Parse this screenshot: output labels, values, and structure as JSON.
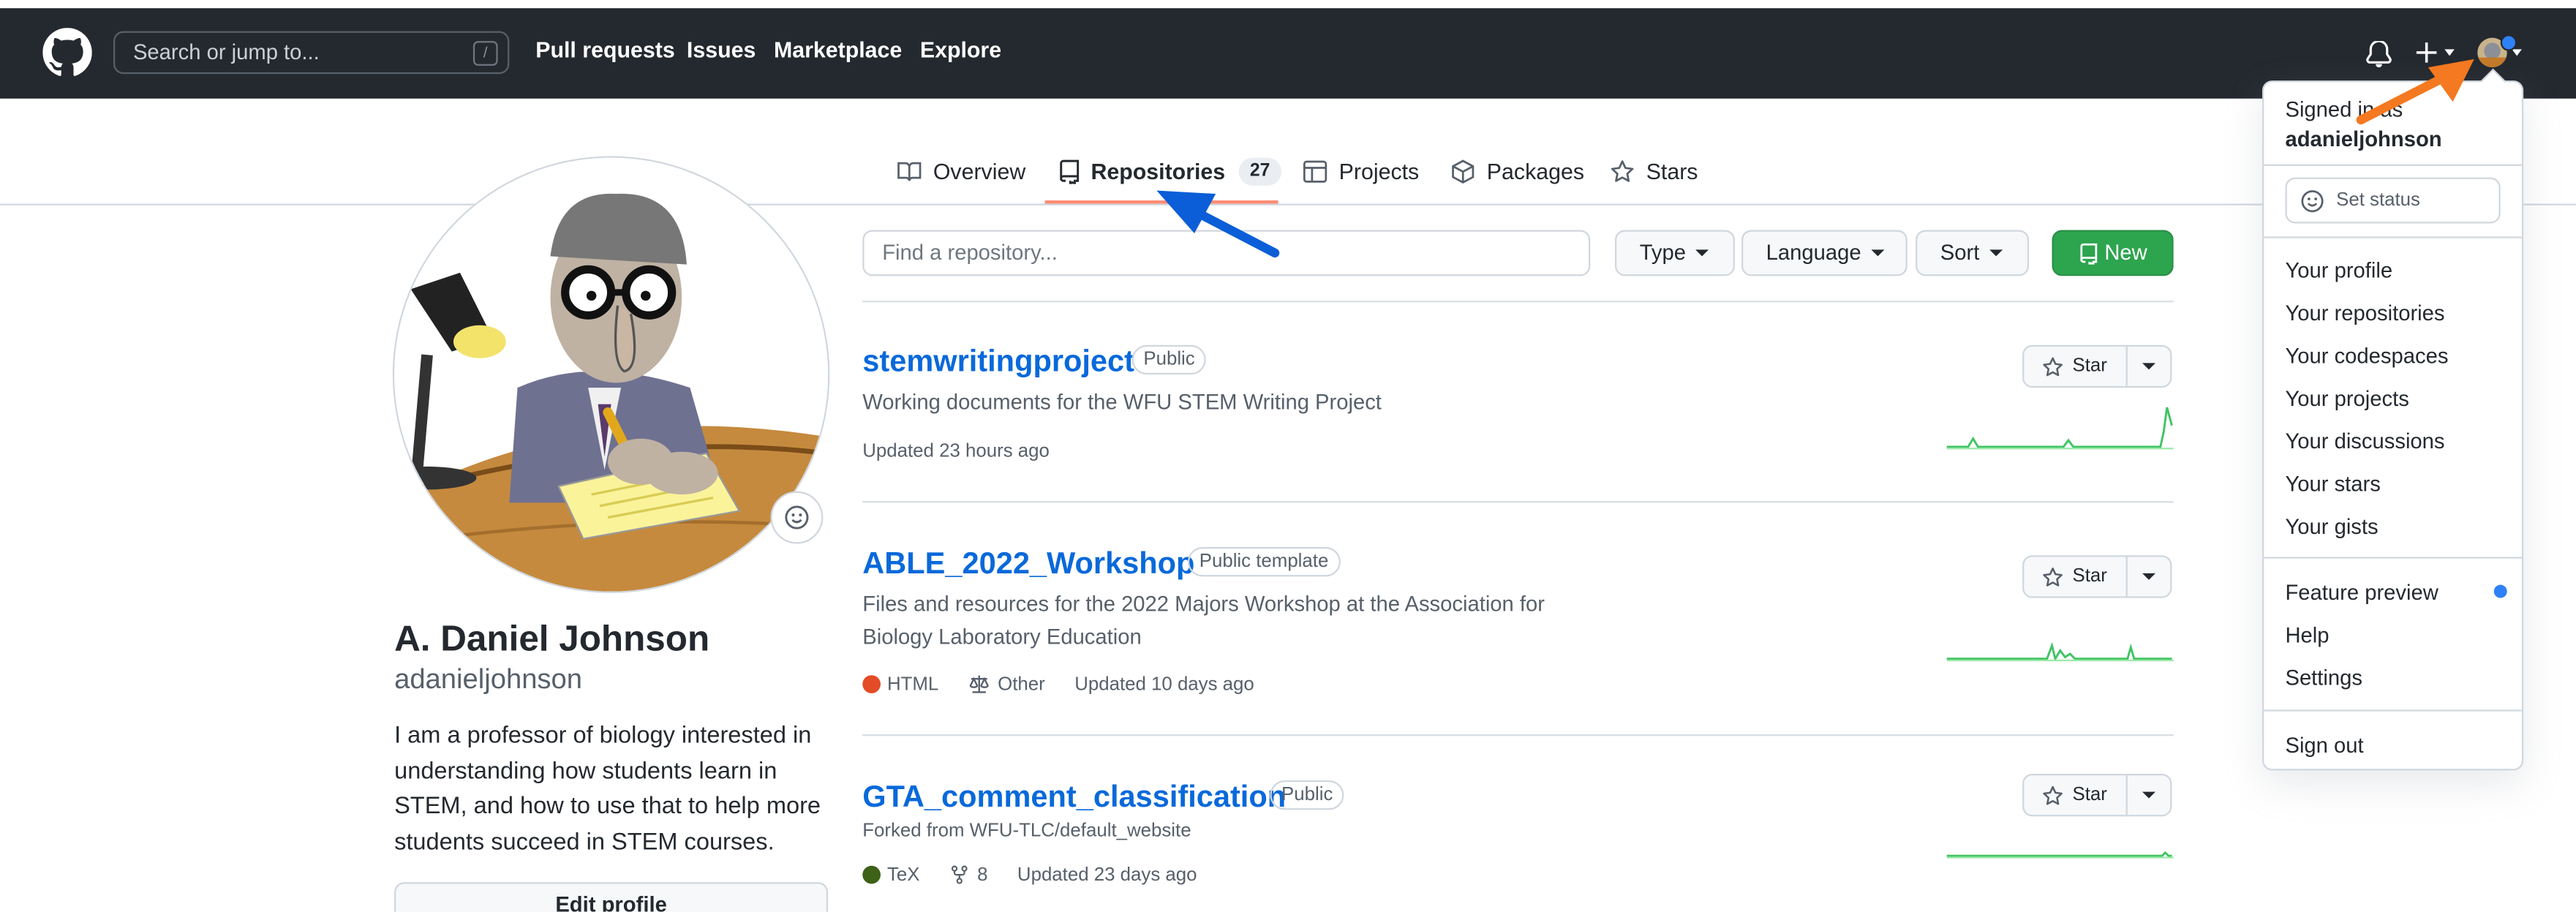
{
  "header": {
    "search_placeholder": "Search or jump to...",
    "search_shortcut": "/",
    "nav": [
      "Pull requests",
      "Issues",
      "Marketplace",
      "Explore"
    ],
    "icons": [
      "github-logo-icon",
      "bell-icon",
      "plus-icon",
      "avatar"
    ]
  },
  "tabs": [
    {
      "label": "Overview",
      "icon": "book-icon"
    },
    {
      "label": "Repositories",
      "icon": "repo-icon",
      "count": "27",
      "selected": true
    },
    {
      "label": "Projects",
      "icon": "table-icon"
    },
    {
      "label": "Packages",
      "icon": "package-icon"
    },
    {
      "label": "Stars",
      "icon": "star-icon"
    }
  ],
  "profile": {
    "full_name": "A. Daniel Johnson",
    "username": "adanieljohnson",
    "bio": "I am a professor of biology interested in understanding how students learn in STEM, and how to use that to help more students succeed in STEM courses.",
    "edit_label": "Edit profile"
  },
  "repo_filter": {
    "placeholder": "Find a repository...",
    "type_label": "Type",
    "language_label": "Language",
    "sort_label": "Sort",
    "new_label": "New"
  },
  "repos": [
    {
      "name": "stemwritingproject",
      "visibility": "Public",
      "description": "Working documents for the WFU STEM Writing Project",
      "updated": "Updated 23 hours ago",
      "star_label": "Star"
    },
    {
      "name": "ABLE_2022_Workshop",
      "visibility": "Public template",
      "description": "Files and resources for the 2022 Majors Workshop at the Association for Biology Laboratory Education",
      "language": "HTML",
      "language_color": "#e34c26",
      "license": "Other",
      "updated": "Updated 10 days ago",
      "star_label": "Star"
    },
    {
      "name": "GTA_comment_classification",
      "visibility": "Public",
      "forked_from": "Forked from WFU-TLC/default_website",
      "language": "TeX",
      "language_color": "#3d6117",
      "forks": "8",
      "updated": "Updated 23 days ago",
      "star_label": "Star"
    }
  ],
  "user_menu": {
    "signed_in_as": "Signed in as",
    "username": "adanieljohnson",
    "set_status": "Set status",
    "group1": [
      "Your profile",
      "Your repositories",
      "Your codespaces",
      "Your projects",
      "Your discussions",
      "Your stars",
      "Your gists"
    ],
    "group2": [
      "Feature preview",
      "Help",
      "Settings"
    ],
    "sign_out": "Sign out"
  },
  "colors": {
    "header_bg": "#24292f",
    "link_blue": "#0969da",
    "new_button_green": "#2da44e",
    "tab_underline": "#fd8c73",
    "annotation_blue_arrow": "#0b5ed7",
    "annotation_orange_arrow": "#f47920",
    "notification_dot": "#2f81f7"
  }
}
